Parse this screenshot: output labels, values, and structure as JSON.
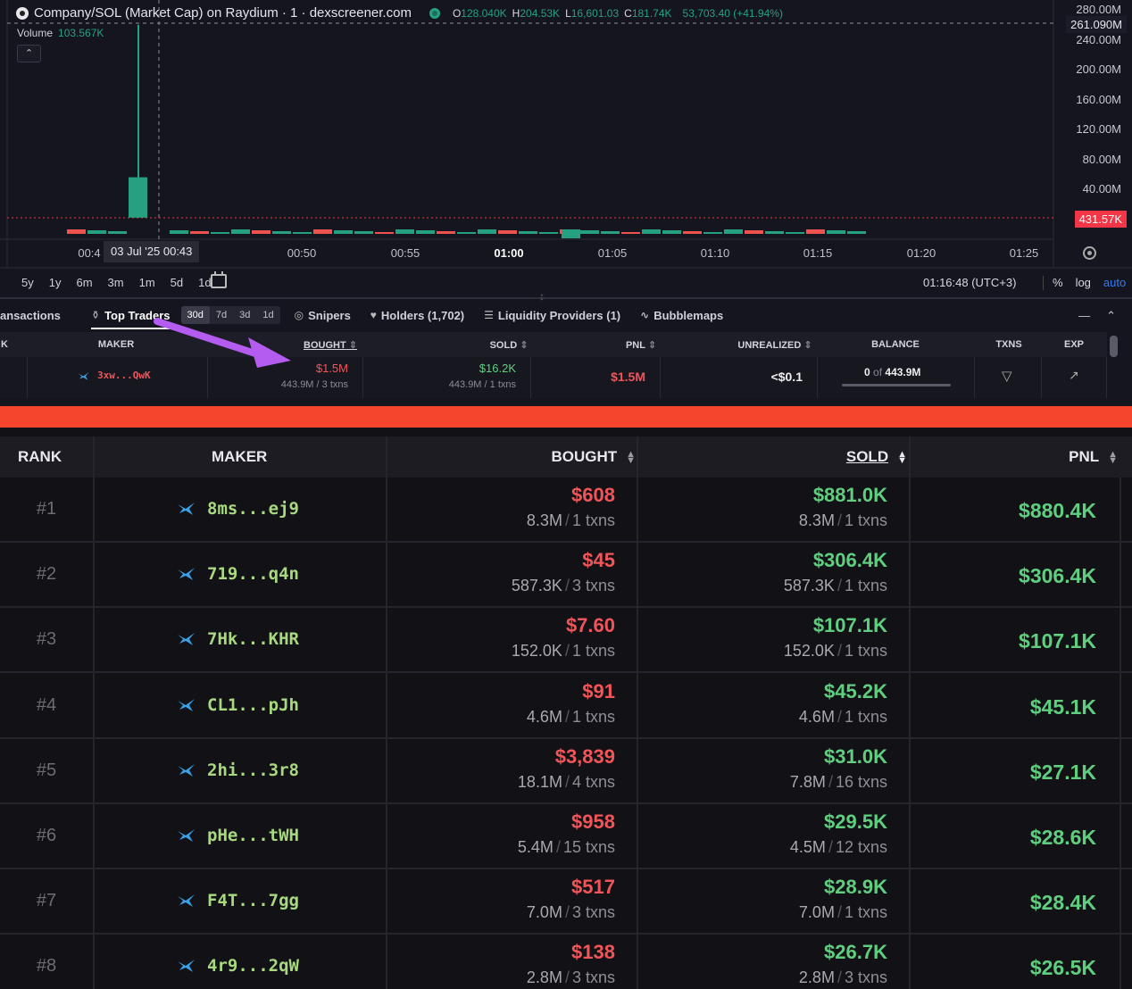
{
  "chart": {
    "title": "Company/SOL (Market Cap) on Raydium · 1 · dexscreener.com",
    "ohlc": [
      {
        "k": "O",
        "v": "128.040K"
      },
      {
        "k": "H",
        "v": "204.53K"
      },
      {
        "k": "L",
        "v": "16,601.03"
      },
      {
        "k": "C",
        "v": "181.74K"
      }
    ],
    "change": "53,703.40 (+41.94%)",
    "volume_label": "Volume",
    "volume_value": "103.567K",
    "y_ticks": [
      "280.00M",
      "240.00M",
      "200.00M",
      "160.00M",
      "120.00M",
      "80.00M",
      "40.00M"
    ],
    "y_tag_current": "261.090M",
    "y_tag_last": "431.57K",
    "x_ticks": [
      "00:4",
      "00:50",
      "00:55",
      "01:00",
      "01:05",
      "01:10",
      "01:15",
      "01:20",
      "01:25"
    ],
    "x_hover": "03 Jul '25   00:43",
    "ranges": [
      "5y",
      "1y",
      "6m",
      "3m",
      "1m",
      "5d",
      "1d"
    ],
    "time_readout": "01:16:48 (UTC+3)",
    "scale": {
      "percent": "%",
      "log": "log",
      "auto": "auto"
    },
    "spike": {
      "open_cap_m": 2,
      "close_cap_m": 56,
      "high_cap_m": 260,
      "volume_rel": 1.0
    },
    "colors": {
      "up": "#26a17f",
      "down": "#ef5350",
      "last_price": "#f23645"
    }
  },
  "tabs": {
    "transactions": "ansactions",
    "top_traders": "Top Traders",
    "periods": [
      "30d",
      "7d",
      "3d",
      "1d"
    ],
    "snipers": "Snipers",
    "holders": "Holders (1,702)",
    "liquidity": "Liquidity Providers (1)",
    "bubblemaps": "Bubblemaps"
  },
  "small_table": {
    "headers": {
      "k": "K",
      "maker": "MAKER",
      "bought": "BOUGHT",
      "sold": "SOLD",
      "pnl": "PNL",
      "unrealized": "UNREALIZED",
      "balance": "BALANCE",
      "txns": "TXNS",
      "exp": "EXP"
    },
    "row": {
      "maker": "3xw...QwK",
      "bought": "$1.5M",
      "bought_sub": "443.9M / 3 txns",
      "sold": "$16.2K",
      "sold_sub": "443.9M / 1 txns",
      "pnl": "$1.5M",
      "unrealized": "<$0.1",
      "balance_left": "0",
      "balance_of": "of",
      "balance_total": "443.9M"
    }
  },
  "big_table": {
    "headers": {
      "rank": "RANK",
      "maker": "MAKER",
      "bought": "BOUGHT",
      "sold": "SOLD",
      "pnl": "PNL"
    },
    "rows": [
      {
        "rank": "#1",
        "maker": "8ms...ej9",
        "bought": "$608",
        "b_amt": "8.3M",
        "b_tx": "1 txns",
        "sold": "$881.0K",
        "s_amt": "8.3M",
        "s_tx": "1 txns",
        "pnl": "$880.4K"
      },
      {
        "rank": "#2",
        "maker": "719...q4n",
        "bought": "$45",
        "b_amt": "587.3K",
        "b_tx": "3 txns",
        "sold": "$306.4K",
        "s_amt": "587.3K",
        "s_tx": "1 txns",
        "pnl": "$306.4K"
      },
      {
        "rank": "#3",
        "maker": "7Hk...KHR",
        "bought": "$7.60",
        "b_amt": "152.0K",
        "b_tx": "1 txns",
        "sold": "$107.1K",
        "s_amt": "152.0K",
        "s_tx": "1 txns",
        "pnl": "$107.1K"
      },
      {
        "rank": "#4",
        "maker": "CL1...pJh",
        "bought": "$91",
        "b_amt": "4.6M",
        "b_tx": "1 txns",
        "sold": "$45.2K",
        "s_amt": "4.6M",
        "s_tx": "1 txns",
        "pnl": "$45.1K"
      },
      {
        "rank": "#5",
        "maker": "2hi...3r8",
        "bought": "$3,839",
        "b_amt": "18.1M",
        "b_tx": "4 txns",
        "sold": "$31.0K",
        "s_amt": "7.8M",
        "s_tx": "16 txns",
        "pnl": "$27.1K"
      },
      {
        "rank": "#6",
        "maker": "pHe...tWH",
        "bought": "$958",
        "b_amt": "5.4M",
        "b_tx": "15 txns",
        "sold": "$29.5K",
        "s_amt": "4.5M",
        "s_tx": "12 txns",
        "pnl": "$28.6K"
      },
      {
        "rank": "#7",
        "maker": "F4T...7gg",
        "bought": "$517",
        "b_amt": "7.0M",
        "b_tx": "3 txns",
        "sold": "$28.9K",
        "s_amt": "7.0M",
        "s_tx": "1 txns",
        "pnl": "$28.4K"
      },
      {
        "rank": "#8",
        "maker": "4r9...2qW",
        "bought": "$138",
        "b_amt": "2.8M",
        "b_tx": "3 txns",
        "sold": "$26.7K",
        "s_amt": "2.8M",
        "s_tx": "3 txns",
        "pnl": "$26.5K"
      }
    ]
  },
  "colors": {
    "divider": "#f5452d",
    "arrow": "#b45cf0",
    "buy": "#f0555a",
    "sell": "#5fcf7f",
    "maker": "#a8d880",
    "bird": "#3aa0e8"
  }
}
